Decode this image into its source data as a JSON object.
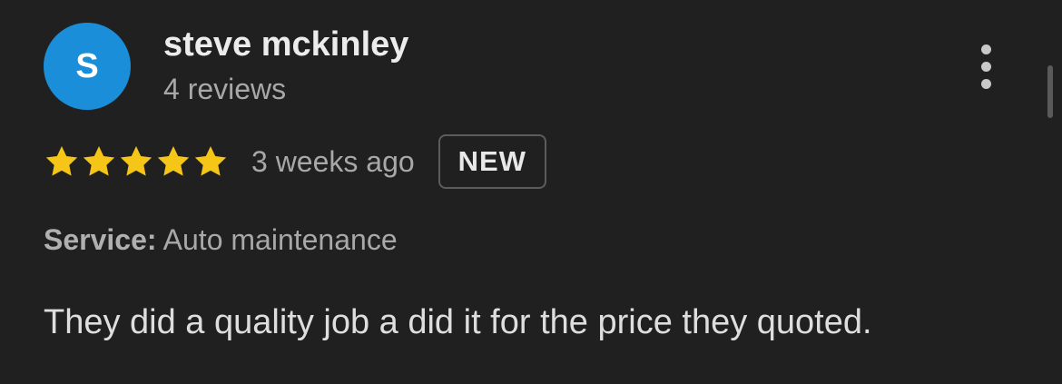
{
  "reviewer": {
    "avatar_initial": "S",
    "name": "steve mckinley",
    "review_count": "4 reviews"
  },
  "review": {
    "rating": 5,
    "rating_max": 5,
    "time_ago": "3 weeks ago",
    "badge": "NEW",
    "service_label": "Service:",
    "service_value": "Auto maintenance",
    "text": "They did a quality job a did it for the price they quoted."
  },
  "icons": {
    "more": "more-vertical-icon",
    "star": "star-icon"
  },
  "colors": {
    "background": "#202020",
    "avatar": "#1a8ed8",
    "star": "#f5c518"
  }
}
